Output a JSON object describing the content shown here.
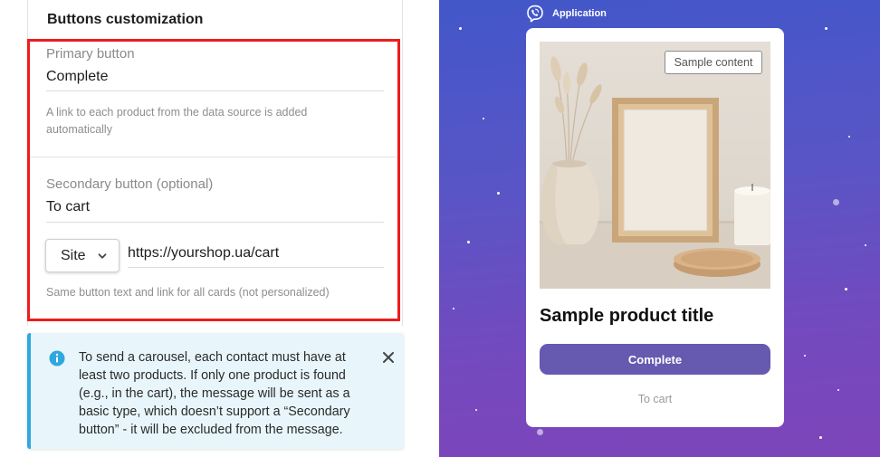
{
  "settings": {
    "section_title": "Buttons customization",
    "primary": {
      "label": "Primary button",
      "value": "Complete",
      "hint": "A link to each product from the data source is added automatically"
    },
    "secondary": {
      "label": "Secondary button (optional)",
      "value": "To cart",
      "link_type": "Site",
      "url": "https://yourshop.ua/cart",
      "hint": "Same button text and link for all cards (not personalized)"
    }
  },
  "alert": {
    "text": "To send a carousel, each contact must have at least two products. If only one product is found (e.g., in the cart), the message will be sent as a basic type, which doesn’t support a “Secondary button” - it will be excluded from the message."
  },
  "preview": {
    "app_name": "Application",
    "badge": "Sample content",
    "product_title": "Sample product title",
    "primary_button": "Complete",
    "secondary_button": "To cart"
  },
  "colors": {
    "highlight": "#ee1c1c",
    "primary_button": "#6559b0",
    "info_accent": "#2fa8dd",
    "preview_gradient_top": "#4257c9",
    "preview_gradient_bottom": "#7c45b9"
  }
}
